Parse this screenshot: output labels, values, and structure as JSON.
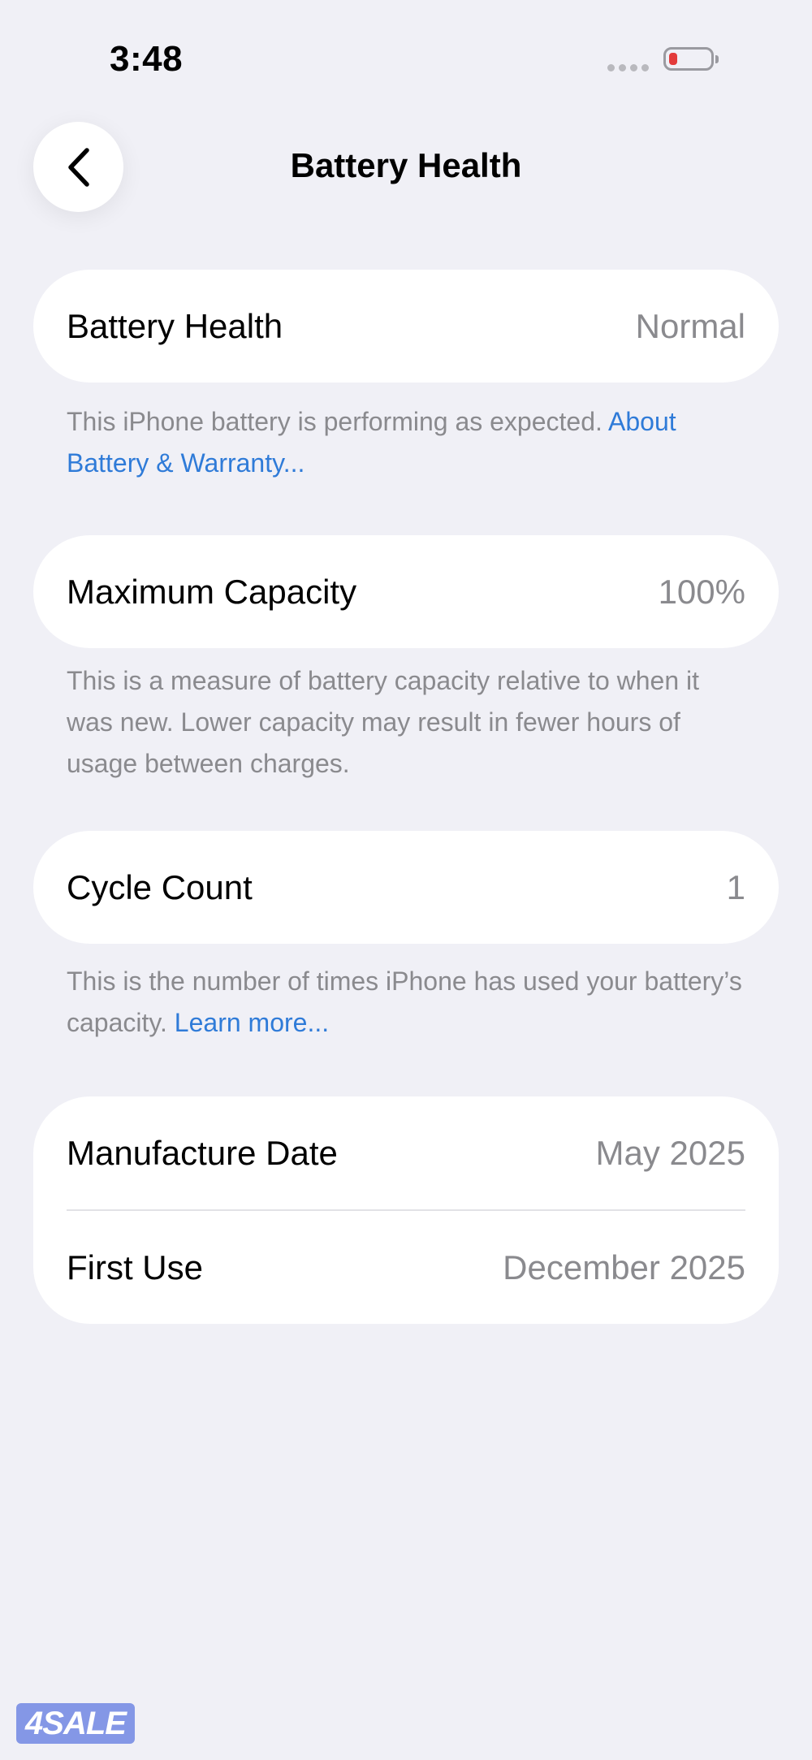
{
  "status_bar": {
    "time": "3:48",
    "battery_color": "#E33B3B"
  },
  "nav": {
    "back_icon": "chevron-left-icon",
    "title": "Battery Health"
  },
  "sections": {
    "health": {
      "label": "Battery Health",
      "value": "Normal",
      "footnote_text": "This iPhone battery is performing as expected. ",
      "footnote_link": "About Battery & Warranty..."
    },
    "capacity": {
      "label": "Maximum Capacity",
      "value": "100%",
      "footnote_text": "This is a measure of battery capacity relative to when it was new. Lower capacity may result in fewer hours of usage between charges."
    },
    "cycle": {
      "label": "Cycle Count",
      "value": "1",
      "footnote_text": "This is the number of times iPhone has used your battery’s capacity. ",
      "footnote_link": "Learn more..."
    },
    "dates": {
      "manufacture_label": "Manufacture Date",
      "manufacture_value": "May 2025",
      "first_use_label": "First Use",
      "first_use_value": "December 2025"
    }
  },
  "watermark": {
    "text": "4SALE"
  },
  "colors": {
    "background": "#F0F0F6",
    "link": "#2F7BD8",
    "secondary_text": "#8A8A8E"
  }
}
